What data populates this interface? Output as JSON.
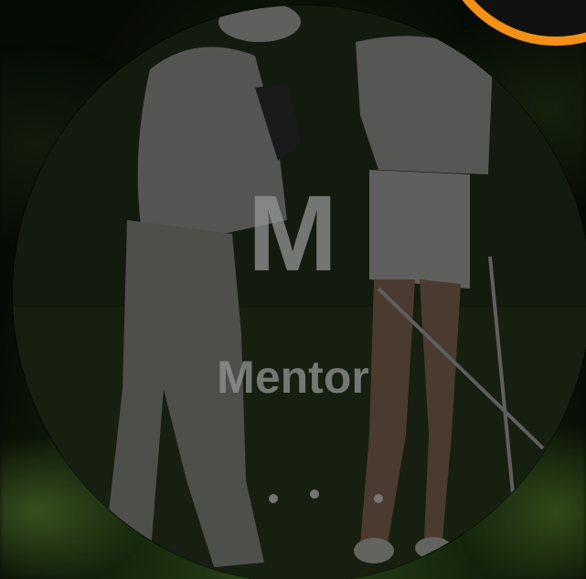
{
  "card": {
    "initial": "M",
    "role": "Mentor"
  },
  "colors": {
    "accent": "#f39016",
    "label": "#969696"
  },
  "icons": {
    "accent_arc": "orange-ring"
  }
}
